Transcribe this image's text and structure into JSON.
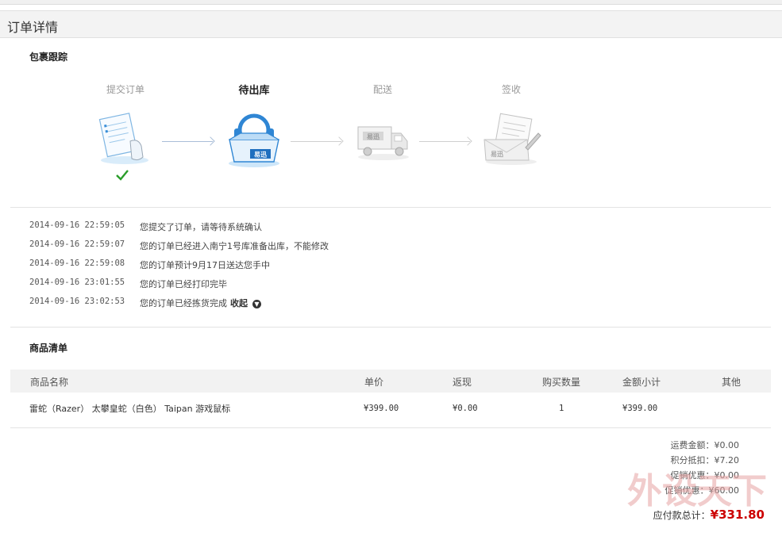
{
  "page": {
    "title": "订单详情"
  },
  "tracking": {
    "section_title": "包裹跟踪",
    "steps": [
      {
        "label": "提交订单",
        "state": "done",
        "icon": "order-form-icon"
      },
      {
        "label": "待出库",
        "state": "current",
        "icon": "package-box-icon"
      },
      {
        "label": "配送",
        "state": "pending",
        "icon": "delivery-truck-icon"
      },
      {
        "label": "签收",
        "state": "pending",
        "icon": "signed-receipt-icon"
      }
    ],
    "brand_label": "易迅",
    "log": [
      {
        "time": "2014-09-16 22:59:05",
        "message": "您提交了订单，请等待系统确认"
      },
      {
        "time": "2014-09-16 22:59:07",
        "message": "您的订单已经进入南宁1号库准备出库，不能修改"
      },
      {
        "time": "2014-09-16 22:59:08",
        "message": "您的订单预计9月17日送达您手中"
      },
      {
        "time": "2014-09-16 23:01:55",
        "message": "您的订单已经打印完毕"
      },
      {
        "time": "2014-09-16 23:02:53",
        "message": "您的订单已经拣货完成"
      }
    ],
    "collapse_label": "收起"
  },
  "products": {
    "section_title": "商品清单",
    "columns": [
      "商品名称",
      "单价",
      "返现",
      "购买数量",
      "金额小计",
      "其他"
    ],
    "rows": [
      {
        "name": "雷蛇（Razer） 太攀皇蛇（白色） Taipan 游戏鼠标",
        "price": "¥399.00",
        "cashback": "¥0.00",
        "qty": "1",
        "subtotal": "¥399.00",
        "other": ""
      }
    ]
  },
  "summary": {
    "lines": [
      "运费金额：¥0.00",
      "积分抵扣：¥7.20",
      "促销优惠：¥0.00",
      "促销优惠：¥60.00"
    ],
    "total_label": "应付款总计：",
    "total_value": "¥331.80"
  },
  "colors": {
    "accent_blue": "#3a8fd8",
    "check_green": "#2a9d2a",
    "total_red": "#cc0000"
  }
}
